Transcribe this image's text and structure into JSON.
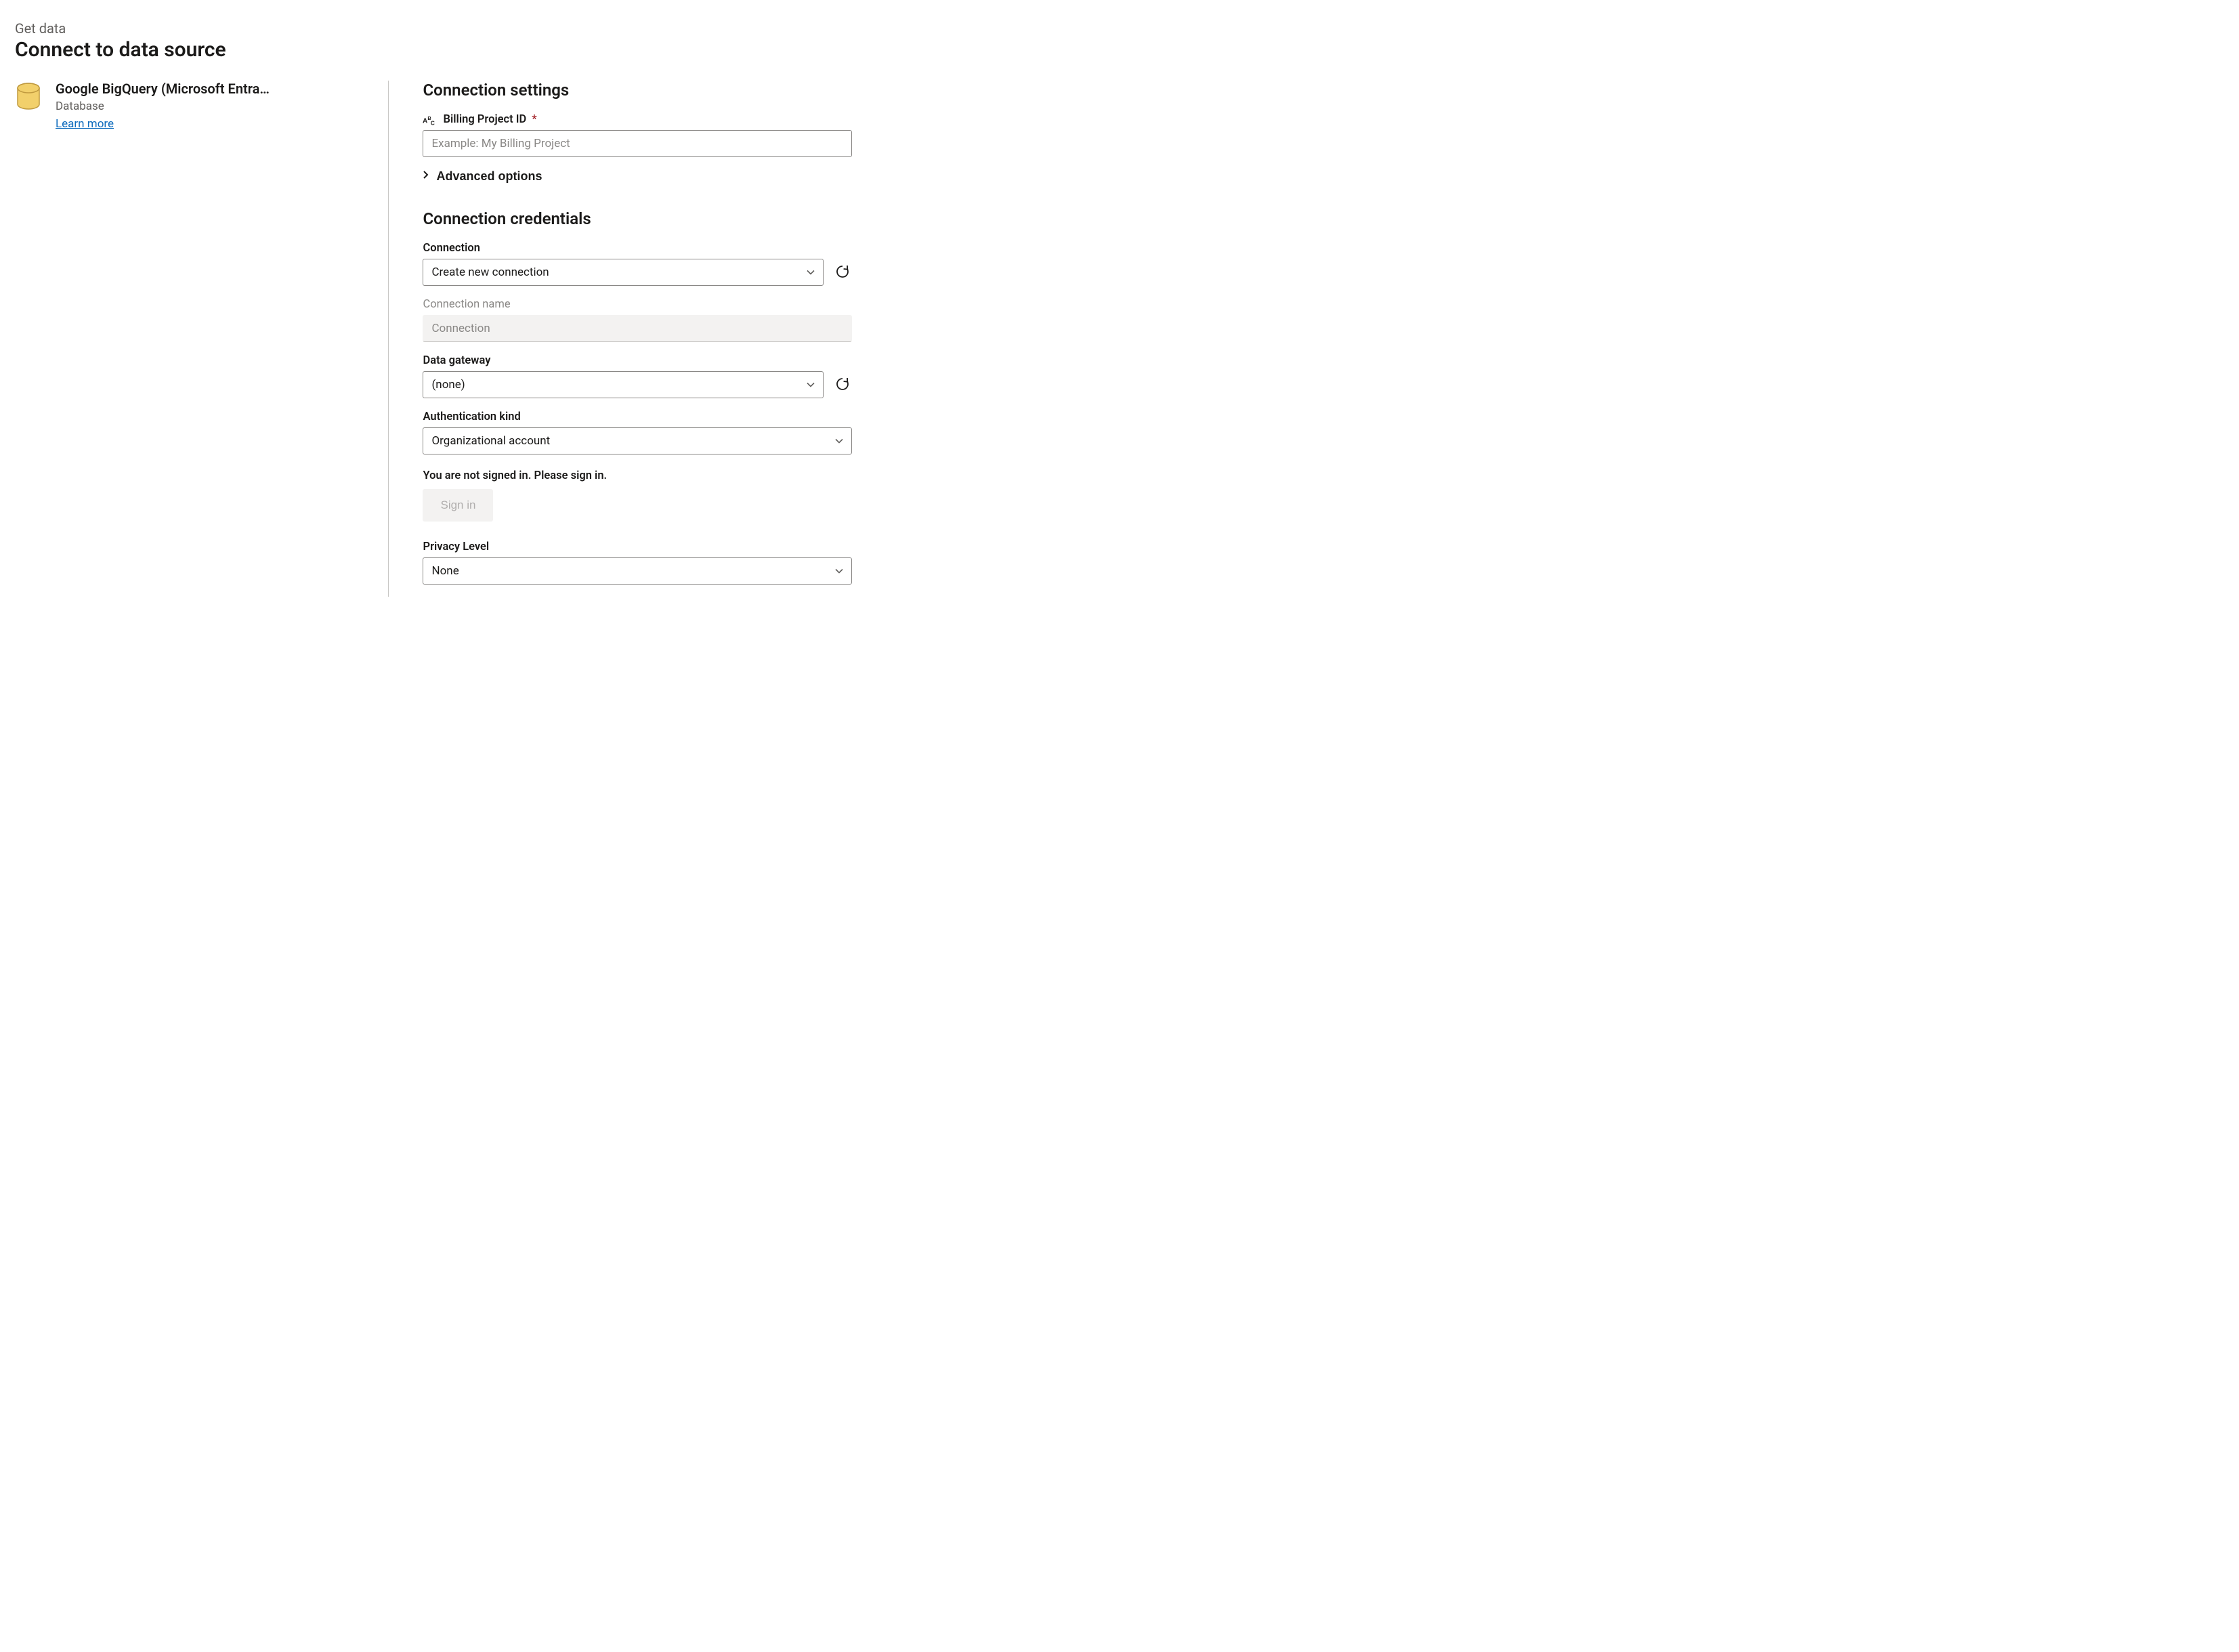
{
  "header": {
    "eyebrow": "Get data",
    "title": "Connect to data source"
  },
  "connector": {
    "name": "Google BigQuery (Microsoft Entra…",
    "kind": "Database",
    "learn_more_label": "Learn more"
  },
  "settings": {
    "heading": "Connection settings",
    "billing_project": {
      "label": "Billing Project ID",
      "required_mark": "*",
      "placeholder": "Example: My Billing Project",
      "value": ""
    },
    "advanced_label": "Advanced options"
  },
  "credentials": {
    "heading": "Connection credentials",
    "connection": {
      "label": "Connection",
      "value": "Create new connection"
    },
    "connection_name": {
      "label": "Connection name",
      "value": "Connection"
    },
    "data_gateway": {
      "label": "Data gateway",
      "value": "(none)"
    },
    "auth_kind": {
      "label": "Authentication kind",
      "value": "Organizational account"
    },
    "signin_message": "You are not signed in. Please sign in.",
    "signin_button": "Sign in",
    "privacy": {
      "label": "Privacy Level",
      "value": "None"
    }
  }
}
